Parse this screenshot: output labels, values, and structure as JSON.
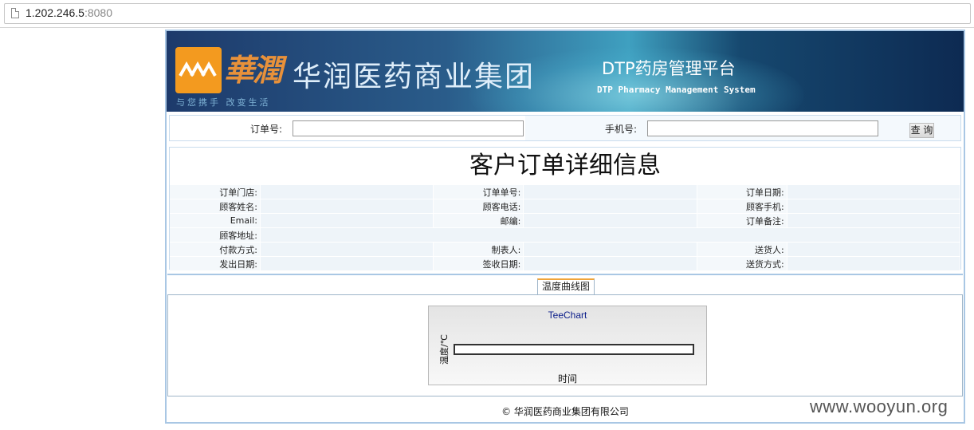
{
  "browser": {
    "url_host": "1.202.246.5",
    "url_port": ":8080"
  },
  "banner": {
    "logo_calligraphy": "華潤",
    "company_name": "华润医药商业集团",
    "slogan": "与您携手 改变生活",
    "system_title": "DTP药房管理平台",
    "system_subtitle": "DTP Pharmacy Management System"
  },
  "search": {
    "order_no_label": "订单号:",
    "order_no_value": "",
    "phone_label": "手机号:",
    "phone_value": "",
    "query_button": "查 询"
  },
  "detail": {
    "title": "客户订单详细信息",
    "rows": [
      [
        {
          "label": "订单门店:",
          "value": ""
        },
        {
          "label": "订单单号:",
          "value": ""
        },
        {
          "label": "订单日期:",
          "value": ""
        }
      ],
      [
        {
          "label": "顾客姓名:",
          "value": ""
        },
        {
          "label": "顾客电话:",
          "value": ""
        },
        {
          "label": "顾客手机:",
          "value": ""
        }
      ],
      [
        {
          "label": "Email:",
          "value": ""
        },
        {
          "label": "邮编:",
          "value": ""
        },
        {
          "label": "订单备注:",
          "value": ""
        }
      ],
      [
        {
          "label": "顾客地址:",
          "value": ""
        }
      ],
      [
        {
          "label": "付款方式:",
          "value": ""
        },
        {
          "label": "制表人:",
          "value": ""
        },
        {
          "label": "送货人:",
          "value": ""
        }
      ],
      [
        {
          "label": "发出日期:",
          "value": ""
        },
        {
          "label": "签收日期:",
          "value": ""
        },
        {
          "label": "送货方式:",
          "value": ""
        }
      ]
    ]
  },
  "tabs": [
    {
      "label": "温度曲线图",
      "active": true
    }
  ],
  "chart": {
    "title": "TeeChart",
    "ylabel": "温度/℃",
    "xlabel": "时间"
  },
  "footer": {
    "copyright": "© 华润医药商业集团有限公司"
  },
  "watermark": "www.wooyun.org",
  "colors": {
    "frame_border": "#a9c7e4",
    "tab_accent": "#f0a43a",
    "chart_title": "#0b1d8a"
  }
}
